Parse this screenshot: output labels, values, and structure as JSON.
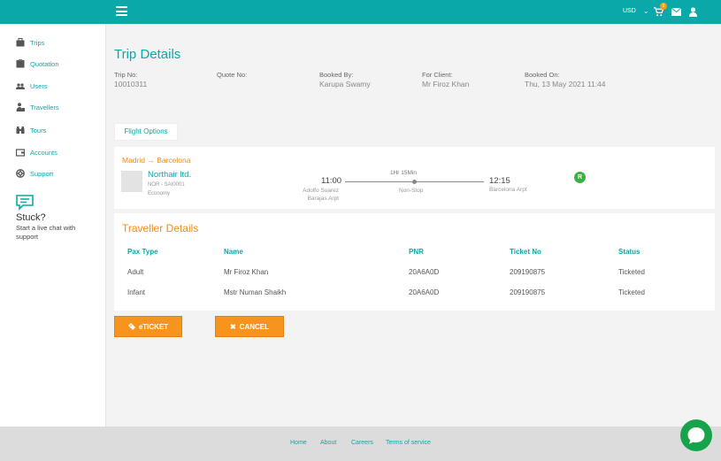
{
  "header": {
    "currency": "USD",
    "cart_count": "0"
  },
  "sidebar": {
    "items": [
      {
        "label": "Trips",
        "icon": "briefcase-icon"
      },
      {
        "label": "Quotation",
        "icon": "document-icon"
      },
      {
        "label": "Users",
        "icon": "users-icon"
      },
      {
        "label": "Travellers",
        "icon": "traveller-icon"
      },
      {
        "label": "Tours",
        "icon": "binoculars-icon"
      },
      {
        "label": "Accounts",
        "icon": "wallet-icon"
      },
      {
        "label": "Support",
        "icon": "lifebuoy-icon"
      }
    ],
    "stuck_title": "Stuck?",
    "stuck_sub": "Start a live chat with support"
  },
  "page": {
    "title": "Trip Details",
    "meta": [
      {
        "label": "Trip No:",
        "value": "10010311"
      },
      {
        "label": "Quote No:",
        "value": ""
      },
      {
        "label": "Booked By:",
        "value": "Karupa Swamy"
      },
      {
        "label": "For Client:",
        "value": "Mr Firoz Khan"
      },
      {
        "label": "Booked On:",
        "value": "Thu, 13 May 2021 11:44"
      }
    ]
  },
  "flight_options_tab": "Flight Options",
  "flight": {
    "route": "Madrid → Barcelona",
    "airline": "Northair ltd.",
    "code": "NOR - SAI0001",
    "cabin": "Economy",
    "dep_time": "11:00",
    "dep_airport": "Adolfo Suarez Barajas Arpt",
    "duration": "1Hr 15Min",
    "stops": "Non-Stop",
    "arr_time": "12:15",
    "arr_airport": "Barcelona Arpt",
    "fare_badge": "R"
  },
  "travellers": {
    "title": "Traveller Details",
    "headers": [
      "Pax Type",
      "Name",
      "PNR",
      "Ticket No",
      "Status"
    ],
    "rows": [
      [
        "Adult",
        "Mr Firoz Khan",
        "20A6A0D",
        "209190875",
        "Ticketed"
      ],
      [
        "Infant",
        "Mstr Numan Shaikh",
        "20A6A0D",
        "209190875",
        "Ticketed"
      ]
    ]
  },
  "buttons": {
    "eticket": "eTICKET",
    "cancel": "CANCEL"
  },
  "footer": {
    "links": [
      "Home",
      "About",
      "Careers",
      "Terms of service"
    ]
  },
  "colors": {
    "brand_teal": "#0aa8a8",
    "accent_orange": "#f7941d",
    "chat_green": "#17a34a"
  }
}
